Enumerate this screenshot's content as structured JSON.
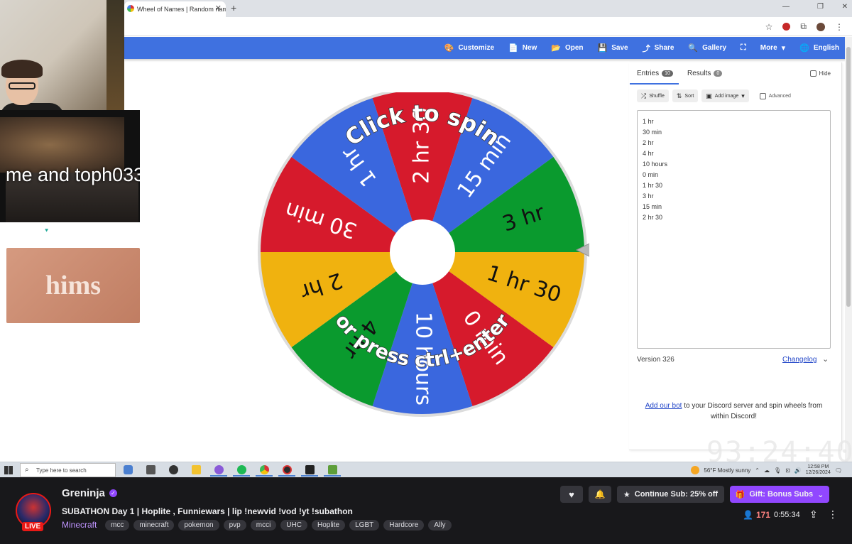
{
  "overlay": {
    "webcam_caption": "me and toph033",
    "ad_brand": "hims"
  },
  "browser": {
    "tab_title": "Wheel of Names | Random name",
    "tab_close": "✕",
    "new_tab": "+",
    "window_controls": [
      "—",
      "❐",
      "✕"
    ]
  },
  "app": {
    "nav": [
      {
        "icon": "palette-icon",
        "glyph": "🎨",
        "label": "Customize"
      },
      {
        "icon": "file-icon",
        "glyph": "📄",
        "label": "New"
      },
      {
        "icon": "folder-open-icon",
        "glyph": "📂",
        "label": "Open"
      },
      {
        "icon": "save-icon",
        "glyph": "💾",
        "label": "Save"
      },
      {
        "icon": "share-icon",
        "glyph": "⤴",
        "label": "Share"
      },
      {
        "icon": "search-icon",
        "glyph": "🔍",
        "label": "Gallery"
      },
      {
        "icon": "fullscreen-icon",
        "glyph": "⛶",
        "label": ""
      },
      {
        "icon": "caret-down-icon",
        "glyph": "▾",
        "label": "More"
      },
      {
        "icon": "globe-icon",
        "glyph": "🌐",
        "label": "English"
      }
    ],
    "wheel": {
      "spin_text_top": "Click to spin",
      "spin_text_bottom": "or press ctrl+enter",
      "colors": {
        "red": "#d61a2c",
        "blue": "#3a67de",
        "green": "#0a9a2e",
        "yellow": "#f0b20f"
      },
      "segments": [
        {
          "label": "2 hr 30",
          "color": "#d61a2c"
        },
        {
          "label": "15 min",
          "color": "#3a67de"
        },
        {
          "label": "3 hr",
          "color": "#0a9a2e"
        },
        {
          "label": "1 hr 30",
          "color": "#f0b20f"
        },
        {
          "label": "0 min",
          "color": "#d61a2c"
        },
        {
          "label": "10 hours",
          "color": "#3a67de"
        },
        {
          "label": "4 hr",
          "color": "#0a9a2e"
        },
        {
          "label": "2 hr",
          "color": "#f0b20f"
        },
        {
          "label": "30 min",
          "color": "#d61a2c"
        },
        {
          "label": "1 hr",
          "color": "#3a67de"
        }
      ]
    },
    "panel": {
      "tab_entries": "Entries",
      "entries_count": "10",
      "tab_results": "Results",
      "results_count": "0",
      "hide_label": "Hide",
      "shuffle_label": "Shuffle",
      "sort_label": "Sort",
      "add_image_label": "Add image",
      "advanced_label": "Advanced",
      "entries": [
        "1 hr",
        "30 min",
        "2 hr",
        "4 hr",
        "10 hours",
        "0 min",
        "1 hr 30",
        "3 hr",
        "15 min",
        "2 hr 30"
      ],
      "version": "Version 326",
      "changelog": "Changelog",
      "discord_link": "Add our bot",
      "discord_text": " to your Discord server and spin wheels from within Discord!"
    },
    "stream_timer": "93:24:40"
  },
  "taskbar": {
    "search_placeholder": "Type here to search",
    "weather": "56°F  Mostly sunny",
    "time": "12:58 PM",
    "date": "12/26/2024"
  },
  "twitch": {
    "live_badge": "LIVE",
    "channel": "Greninja",
    "title": "SUBATHON Day 1 | Hoplite , Funniewars | lip !newvid !vod !yt !subathon",
    "game": "Minecraft",
    "tags": [
      "mcc",
      "minecraft",
      "pokemon",
      "pvp",
      "mcci",
      "UHC",
      "Hoplite",
      "LGBT",
      "Hardcore",
      "Ally"
    ],
    "continue_sub": "Continue Sub: 25% off",
    "gift_subs": "Gift: Bonus Subs",
    "viewers": "171",
    "uptime": "0:55:34"
  }
}
